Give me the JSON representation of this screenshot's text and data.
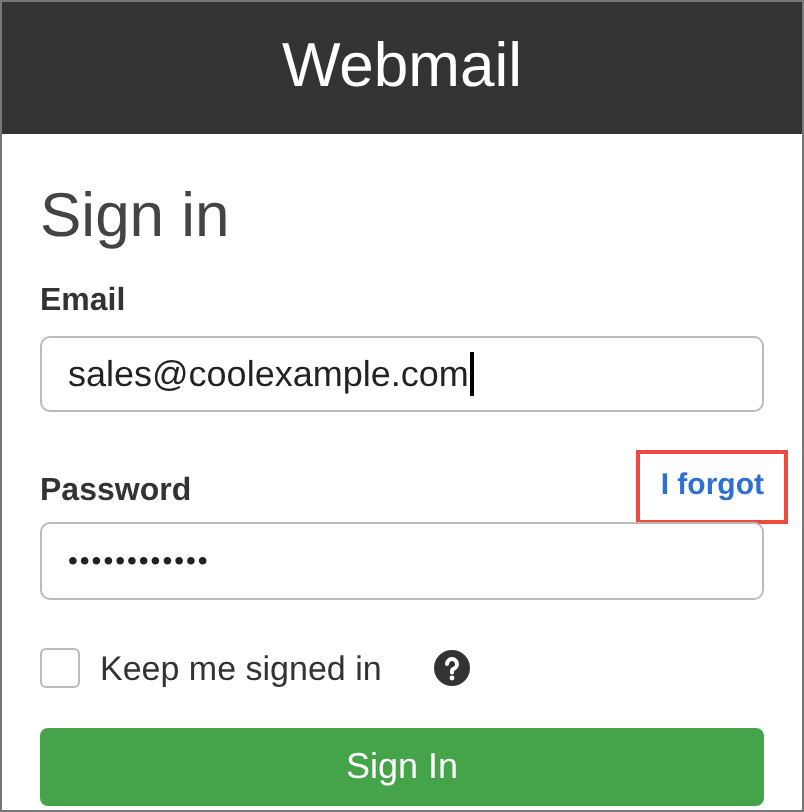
{
  "header": {
    "title": "Webmail"
  },
  "heading": "Sign in",
  "email": {
    "label": "Email",
    "value": "sales@coolexample.com",
    "focused": true
  },
  "password": {
    "label": "Password",
    "value": "••••••••••••",
    "forgot_link": {
      "label": "I forgot",
      "highlighted": true
    }
  },
  "keep_signed_in": {
    "label": "Keep me signed in",
    "checked": false
  },
  "submit_button": "Sign In"
}
